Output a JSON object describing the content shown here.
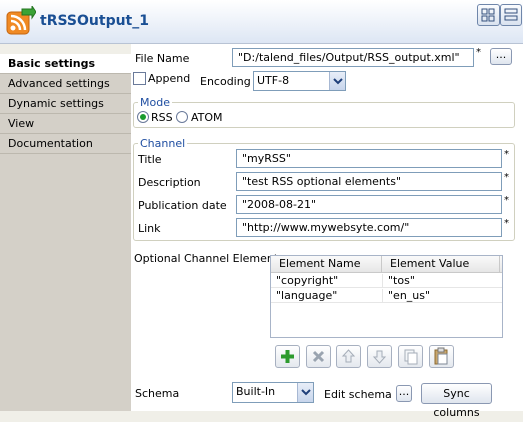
{
  "window": {
    "title": "tRSSOutput_1"
  },
  "sidebar": {
    "items": [
      {
        "label": "Basic settings",
        "active": true
      },
      {
        "label": "Advanced settings",
        "active": false
      },
      {
        "label": "Dynamic settings",
        "active": false
      },
      {
        "label": "View",
        "active": false
      },
      {
        "label": "Documentation",
        "active": false
      }
    ]
  },
  "file": {
    "label": "File Name",
    "value": "\"D:/talend_files/Output/RSS_output.xml\"",
    "required": "*",
    "browse_label": "..."
  },
  "append": {
    "label": "Append",
    "checked": false
  },
  "encoding": {
    "label": "Encoding",
    "value": "UTF-8"
  },
  "mode": {
    "title": "Mode",
    "options": [
      "RSS",
      "ATOM"
    ],
    "selected": "RSS"
  },
  "channel": {
    "title": "Channel",
    "fields": [
      {
        "label": "Title",
        "value": "\"myRSS\"",
        "required": "*"
      },
      {
        "label": "Description",
        "value": "\"test RSS optional elements\"",
        "required": "*"
      },
      {
        "label": "Publication date",
        "value": "\"2008-08-21\"",
        "required": "*"
      },
      {
        "label": "Link",
        "value": "\"http://www.mywebsyte.com/\"",
        "required": "*"
      }
    ]
  },
  "optional": {
    "label": "Optional Channel Elements",
    "columns": [
      "Element Name",
      "Element Value"
    ],
    "rows": [
      [
        "\"copyright\"",
        "\"tos\""
      ],
      [
        "\"language\"",
        "\"en_us\""
      ]
    ]
  },
  "schema": {
    "label": "Schema",
    "value": "Built-In",
    "edit_label": "Edit schema",
    "edit_btn": "...",
    "sync_label": "Sync columns"
  },
  "colors": {
    "accent": "#1a4f94",
    "group_title": "#1f4ea1",
    "add_green": "#2e9b2e"
  }
}
